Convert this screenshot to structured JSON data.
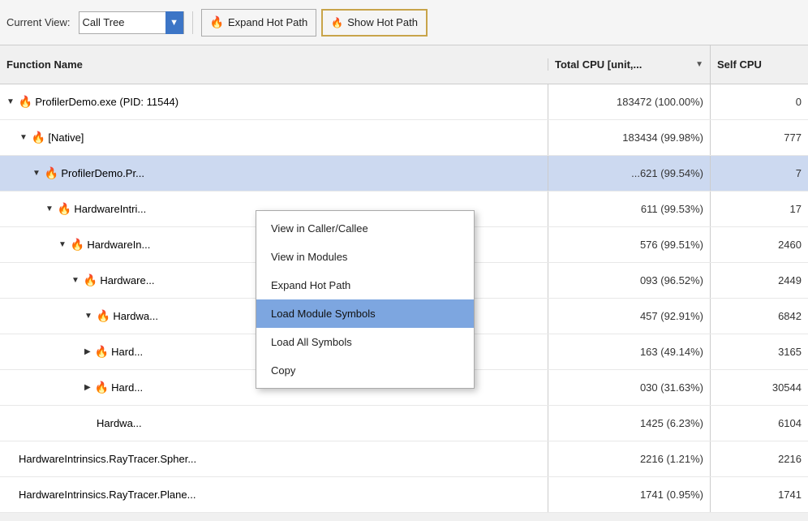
{
  "toolbar": {
    "current_view_label": "Current View:",
    "view_name": "Call Tree",
    "expand_hot_path_label": "Expand Hot Path",
    "show_hot_path_label": "Show Hot Path"
  },
  "columns": {
    "function_name": "Function Name",
    "total_cpu": "Total CPU [unit,...",
    "self_cpu": "Self CPU"
  },
  "rows": [
    {
      "indent": 1,
      "has_expand": true,
      "expanded": true,
      "has_fire": true,
      "name": "ProfilerDemo.exe (PID: 11544)",
      "total_cpu": "183472 (100.00%)",
      "self_cpu": "0"
    },
    {
      "indent": 2,
      "has_expand": true,
      "expanded": true,
      "has_fire": true,
      "name": "[Native]",
      "total_cpu": "183434 (99.98%)",
      "self_cpu": "777"
    },
    {
      "indent": 3,
      "has_expand": true,
      "expanded": true,
      "has_fire": true,
      "name": "ProfilerDemo.Pr...",
      "total_cpu": "...621 (99.54%)",
      "self_cpu": "7",
      "selected": true
    },
    {
      "indent": 4,
      "has_expand": true,
      "expanded": true,
      "has_fire": true,
      "name": "HardwareIntri...",
      "total_cpu": "611 (99.53%)",
      "self_cpu": "17"
    },
    {
      "indent": 5,
      "has_expand": true,
      "expanded": true,
      "has_fire": true,
      "name": "HardwareIn...",
      "total_cpu": "576 (99.51%)",
      "self_cpu": "2460"
    },
    {
      "indent": 6,
      "has_expand": true,
      "expanded": true,
      "has_fire": true,
      "name": "Hardware...",
      "total_cpu": "093 (96.52%)",
      "self_cpu": "2449"
    },
    {
      "indent": 7,
      "has_expand": true,
      "expanded": true,
      "has_fire": true,
      "name": "Hardwa...",
      "total_cpu": "457 (92.91%)",
      "self_cpu": "6842"
    },
    {
      "indent": 7,
      "has_expand": true,
      "expanded": false,
      "has_fire": true,
      "name": "Hard...",
      "total_cpu": "163 (49.14%)",
      "self_cpu": "3165"
    },
    {
      "indent": 7,
      "has_expand": true,
      "expanded": false,
      "has_fire": true,
      "name": "Hard...",
      "total_cpu": "030 (31.63%)",
      "self_cpu": "30544"
    },
    {
      "indent": 7,
      "has_expand": false,
      "expanded": false,
      "has_fire": false,
      "name": "Hardwa...",
      "total_cpu": "1425 (6.23%)",
      "self_cpu": "6104"
    },
    {
      "indent": 1,
      "has_expand": false,
      "expanded": false,
      "has_fire": false,
      "name": "HardwareIntrinsics.RayTracer.Spher...",
      "total_cpu": "2216 (1.21%)",
      "self_cpu": "2216"
    },
    {
      "indent": 1,
      "has_expand": false,
      "expanded": false,
      "has_fire": false,
      "name": "HardwareIntrinsics.RayTracer.Plane...",
      "total_cpu": "1741 (0.95%)",
      "self_cpu": "1741"
    }
  ],
  "context_menu": {
    "items": [
      {
        "label": "View in Caller/Callee",
        "highlighted": false
      },
      {
        "label": "View in Modules",
        "highlighted": false
      },
      {
        "label": "Expand Hot Path",
        "highlighted": false
      },
      {
        "label": "Load Module Symbols",
        "highlighted": true
      },
      {
        "label": "Load All Symbols",
        "highlighted": false
      },
      {
        "label": "Copy",
        "highlighted": false
      }
    ]
  }
}
